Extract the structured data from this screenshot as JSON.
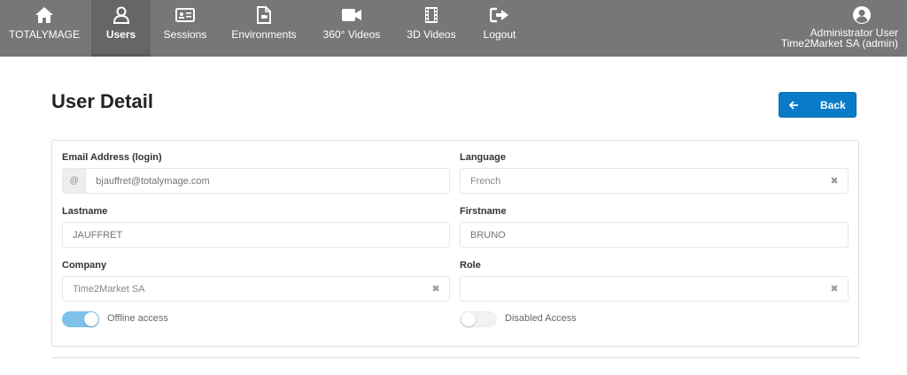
{
  "nav": {
    "items": [
      {
        "label": "TOTALYMAGE",
        "icon": "home-icon"
      },
      {
        "label": "Users",
        "icon": "user-icon"
      },
      {
        "label": "Sessions",
        "icon": "id-card-icon"
      },
      {
        "label": "Environments",
        "icon": "file-icon"
      },
      {
        "label": "360° Videos",
        "icon": "video-camera-icon"
      },
      {
        "label": "3D Videos",
        "icon": "film-icon"
      },
      {
        "label": "Logout",
        "icon": "logout-icon"
      }
    ],
    "active": "Users"
  },
  "user": {
    "name": "Administrator User",
    "org": "Time2Market SA (admin)"
  },
  "page": {
    "title": "User Detail",
    "back_label": "Back"
  },
  "form": {
    "email": {
      "label": "Email Address (login)",
      "addon": "@",
      "placeholder": "bjauffret@totalymage.com",
      "value": ""
    },
    "language": {
      "label": "Language",
      "value": "French",
      "clear": "✖"
    },
    "lastname": {
      "label": "Lastname",
      "placeholder": "JAUFFRET",
      "value": ""
    },
    "firstname": {
      "label": "Firstname",
      "placeholder": "BRUNO",
      "value": ""
    },
    "company": {
      "label": "Company",
      "value": "Time2Market SA",
      "clear": "✖"
    },
    "role": {
      "label": "Role",
      "value": "",
      "clear": "✖"
    },
    "offline_access": {
      "label": "Offline access",
      "on": true
    },
    "disabled_access": {
      "label": "Disabled Access",
      "on": false
    }
  },
  "colors": {
    "nav_bg": "#777777",
    "accent": "#0a7bc9",
    "toggle_on": "#7cc2ea"
  }
}
